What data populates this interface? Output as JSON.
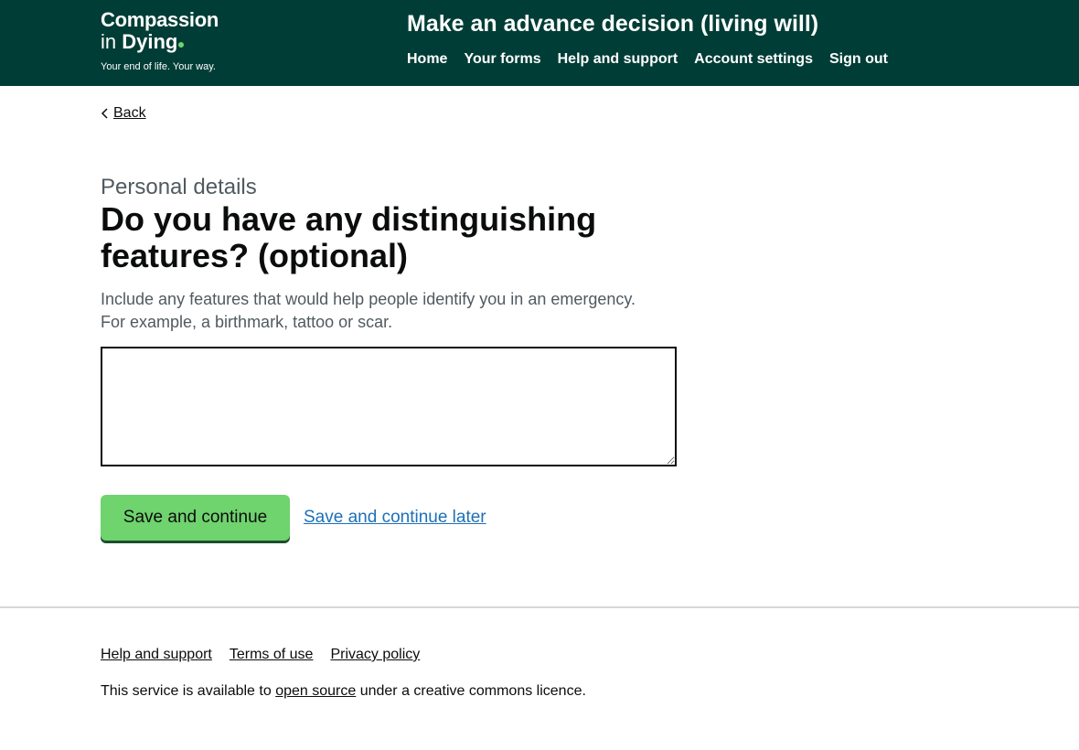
{
  "header": {
    "logo": {
      "line1": "Compassion",
      "line2_a": "in ",
      "line2_b": "Dying",
      "tagline": "Your end of life. Your way."
    },
    "service_name": "Make an advance decision (living will)",
    "nav": [
      "Home",
      "Your forms",
      "Help and support",
      "Account settings",
      "Sign out"
    ]
  },
  "back_link": "Back",
  "form": {
    "caption": "Personal details",
    "heading": "Do you have any distinguishing features? (optional)",
    "hint": "Include any features that would help people identify you in an emergency. For example, a birthmark, tattoo or scar.",
    "textarea_value": "",
    "primary_button": "Save and continue",
    "secondary_link": "Save and continue later"
  },
  "footer": {
    "links": [
      "Help and support",
      "Terms of use",
      "Privacy policy"
    ],
    "licence_before": "This service is available to ",
    "licence_link": "open source",
    "licence_after": " under a creative commons licence."
  },
  "colors": {
    "header_bg": "#003d36",
    "button_green": "#6fd36e",
    "link_blue": "#1d70b8"
  }
}
